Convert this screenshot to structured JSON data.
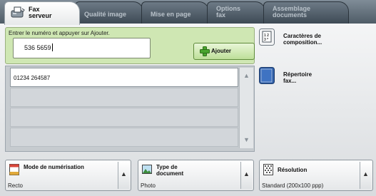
{
  "tabs": [
    {
      "label_line1": "Fax",
      "label_line2": "serveur",
      "active": true,
      "icon": "fax-icon"
    },
    {
      "label": "Qualité image"
    },
    {
      "label": "Mise en page"
    },
    {
      "label_line1": "Options",
      "label_line2": "fax"
    },
    {
      "label_line1": "Assemblage",
      "label_line2": "documents"
    }
  ],
  "entry": {
    "instruction": "Entrer le numéro et appuyer sur Ajouter.",
    "value": "536 5659",
    "add_label": "Ajouter"
  },
  "side_buttons": {
    "characters": {
      "line1": "Caractères de",
      "line2": "composition...",
      "icon": "dial-characters-icon"
    },
    "directory": {
      "line1": "Répertoire",
      "line2": "fax...",
      "icon": "address-book-icon"
    }
  },
  "recipients": [
    "01234 264587",
    "",
    "",
    "",
    ""
  ],
  "bottom": {
    "scan_mode": {
      "title": "Mode de numérisation",
      "value": "Recto",
      "icon": "document-icon"
    },
    "doc_type": {
      "title_line1": "Type de",
      "title_line2": "document",
      "value": "Photo",
      "icon": "photo-icon"
    },
    "resolution": {
      "title": "Résolution",
      "value": "Standard (200x100 ppp)",
      "icon": "resolution-icon"
    }
  },
  "colors": {
    "accent_green": "#cfe7b3",
    "tab_dark": "#4f5c67",
    "directory_blue": "#2f5fa8"
  }
}
